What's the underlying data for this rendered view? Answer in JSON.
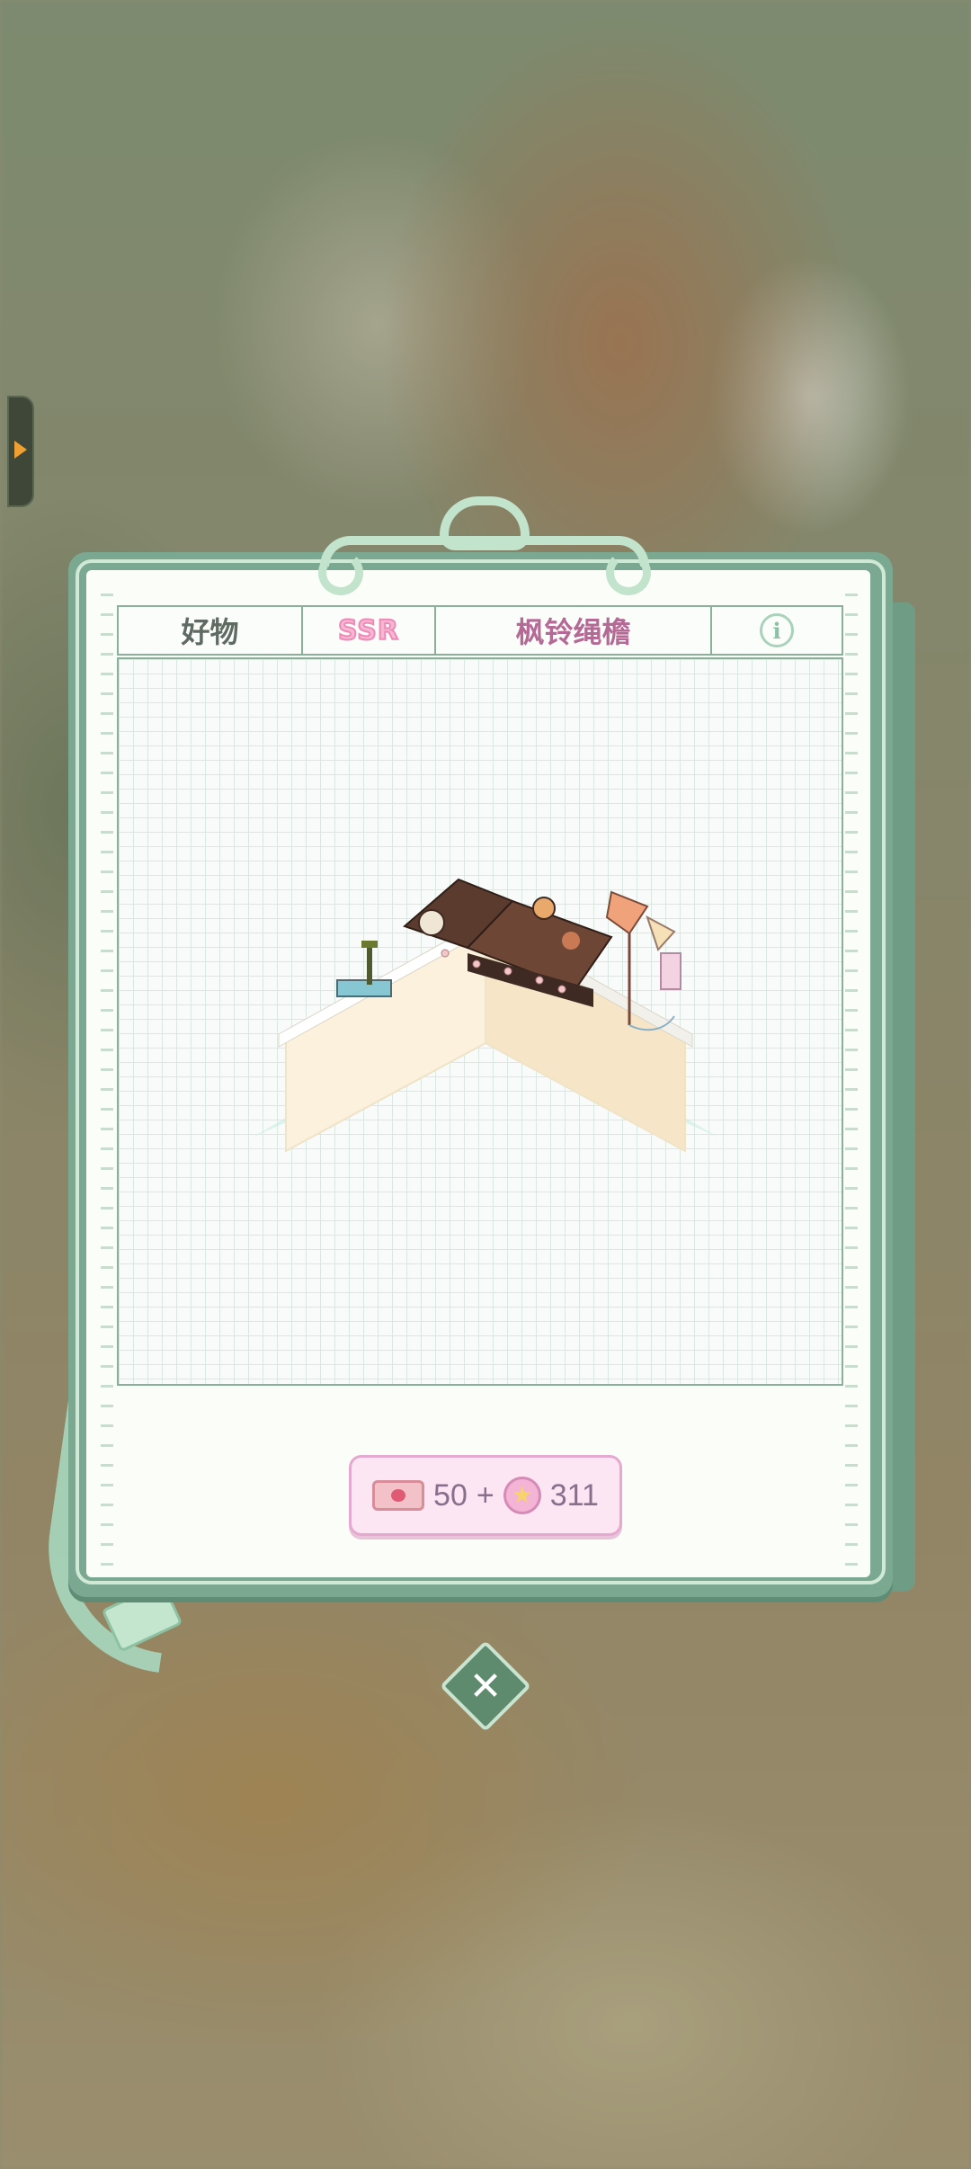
{
  "header": {
    "category": "好物",
    "rarity": "SSR",
    "item_name": "枫铃绳檐",
    "info_glyph": "i"
  },
  "cost": {
    "ticket_amount": "50",
    "plus": "+",
    "star_amount": "311",
    "star_glyph": "★"
  },
  "close": {
    "glyph": "✕"
  },
  "colors": {
    "board": "#7aa891",
    "paper": "#fbfdf9",
    "rarity_pink": "#ee8ab6",
    "name_color": "#b46a95",
    "cost_bg": "#fde6f3"
  },
  "icons": [
    "side-expand-arrow-icon",
    "info-icon",
    "ticket-icon",
    "star-coin-icon",
    "close-icon"
  ]
}
